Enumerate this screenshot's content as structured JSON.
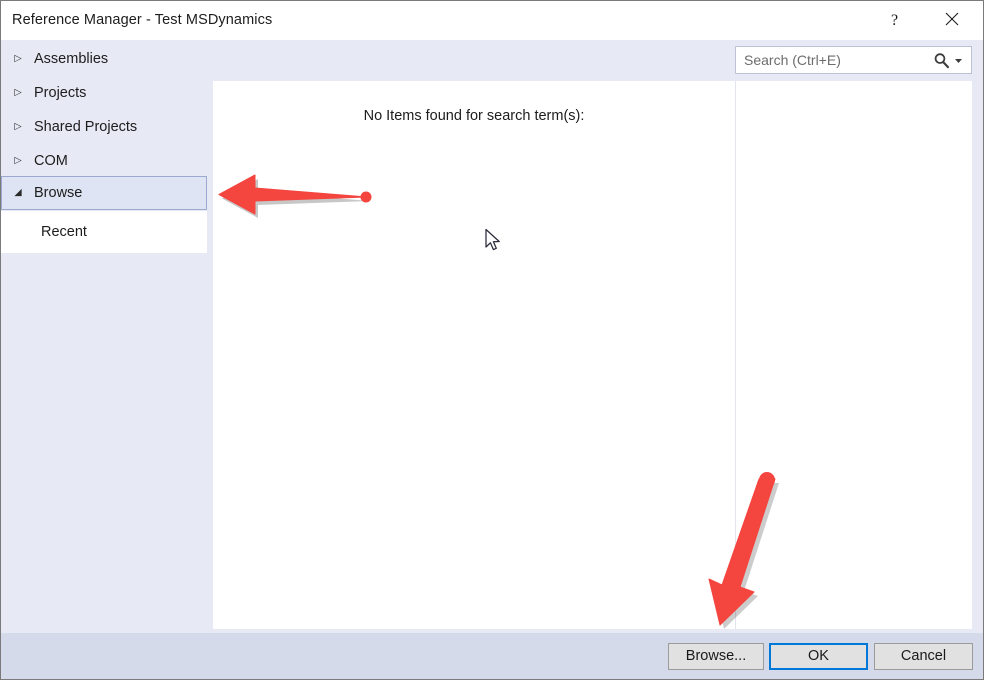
{
  "window": {
    "title": "Reference Manager - Test MSDynamics",
    "help_tooltip": "?",
    "close_tooltip": "×"
  },
  "sidebar": {
    "items": [
      {
        "label": "Assemblies",
        "twisty": "▷",
        "expanded": false,
        "selected": false
      },
      {
        "label": "Projects",
        "twisty": "▷",
        "expanded": false,
        "selected": false
      },
      {
        "label": "Shared Projects",
        "twisty": "▷",
        "expanded": false,
        "selected": false
      },
      {
        "label": "COM",
        "twisty": "▷",
        "expanded": false,
        "selected": false
      },
      {
        "label": "Browse",
        "twisty": "◢",
        "expanded": true,
        "selected": true
      }
    ],
    "children": [
      {
        "label": "Recent",
        "parent": "Browse",
        "selected": false
      }
    ]
  },
  "search": {
    "placeholder": "Search (Ctrl+E)",
    "value": "",
    "icon": "search-icon",
    "dropdown_icon": "chevron-down-icon"
  },
  "main": {
    "empty_message": "No Items found for search term(s):"
  },
  "footer": {
    "browse_label": "Browse...",
    "ok_label": "OK",
    "cancel_label": "Cancel"
  },
  "annotations": {
    "arrow_color": "#f4453f",
    "arrow_to_browse_nav": "points-left-at-browse-sidebar-item",
    "arrow_to_browse_button": "points-down-at-browse-button"
  },
  "colors": {
    "dialog_background": "#e7eaf5",
    "footer_background": "#d4dae9",
    "content_background": "#ffffff",
    "selection_fill": "#dee4f3",
    "selection_border": "#9aa9cd",
    "focus_border": "#0078d7",
    "window_border": "#7a7a7a",
    "text": "#1d1d1d",
    "placeholder_text": "#6d6d6d"
  }
}
